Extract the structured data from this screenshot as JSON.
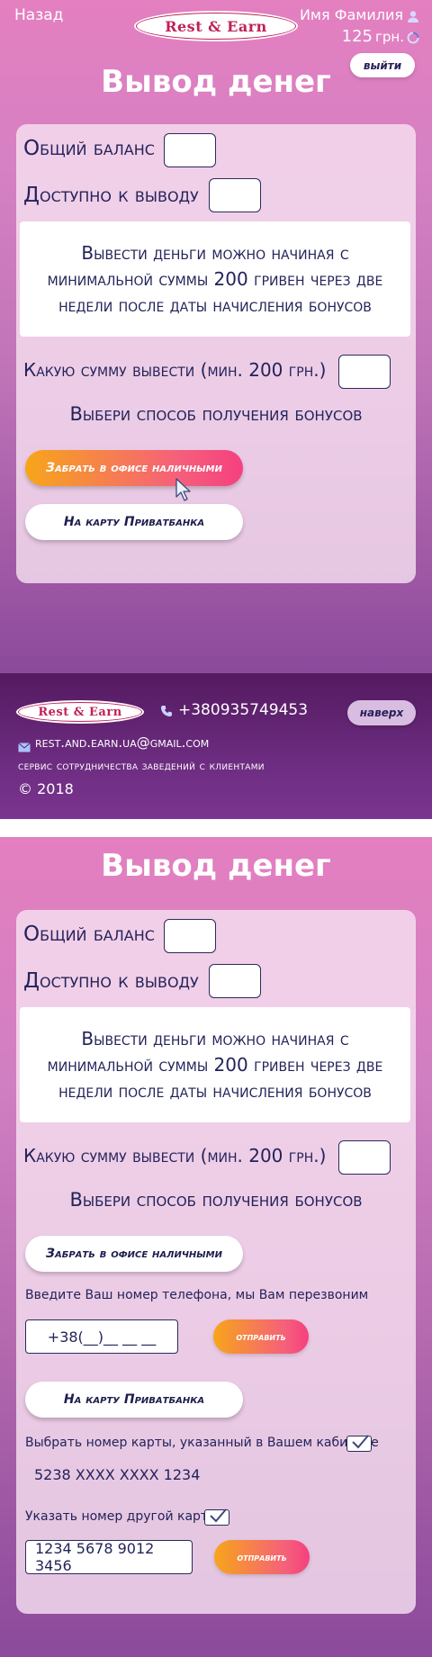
{
  "header": {
    "back_label": "Назад",
    "logo_text": "Rest & Earn",
    "user_name": "Имя Фамилия",
    "balance": "125",
    "currency": "грн.",
    "logout_label": "выйти"
  },
  "page_title": "Вывод денег",
  "form": {
    "total_balance_label": "Общий баланс",
    "available_label": "Доступно к выводу",
    "info_text": "Вывести деньги можно начиная с минимальной суммы 200 гривен через две недели после даты начисления бонусов",
    "amount_label": "Какую сумму вывести (мин. 200 грн.)",
    "choose_method": "Выбери способ получения бонусов",
    "cash_button": "Забрать в офисе наличными",
    "card_button": "На карту Приватбанка"
  },
  "footer": {
    "logo_text": "Rest & Earn",
    "phone": "+380935749453",
    "up_button": "наверх",
    "email": "rest.and.earn.ua@gmail.com",
    "tagline": "сервис сотрудничества заведений с клиентами",
    "copyright": "© 2018"
  },
  "cash_section": {
    "phone_prompt": "Введите Ваш номер телефона, мы Вам перезвоним",
    "phone_value": "+38(__)__ __ __",
    "send_label": "отправить"
  },
  "card_section": {
    "saved_card_label": "Выбрать номер карты, указанный в Вашем кабинете",
    "saved_card_number": "5238 XXXX XXXX 1234",
    "other_card_label": "Указать номер другой карты",
    "other_card_value": "1234 5678 9012 3456",
    "send_label": "отправить"
  },
  "colors": {
    "accent_gradient_start": "#f7a51a",
    "accent_gradient_end": "#f54080",
    "text_dark": "#23235a",
    "footer_bg": "#5e1f70"
  }
}
